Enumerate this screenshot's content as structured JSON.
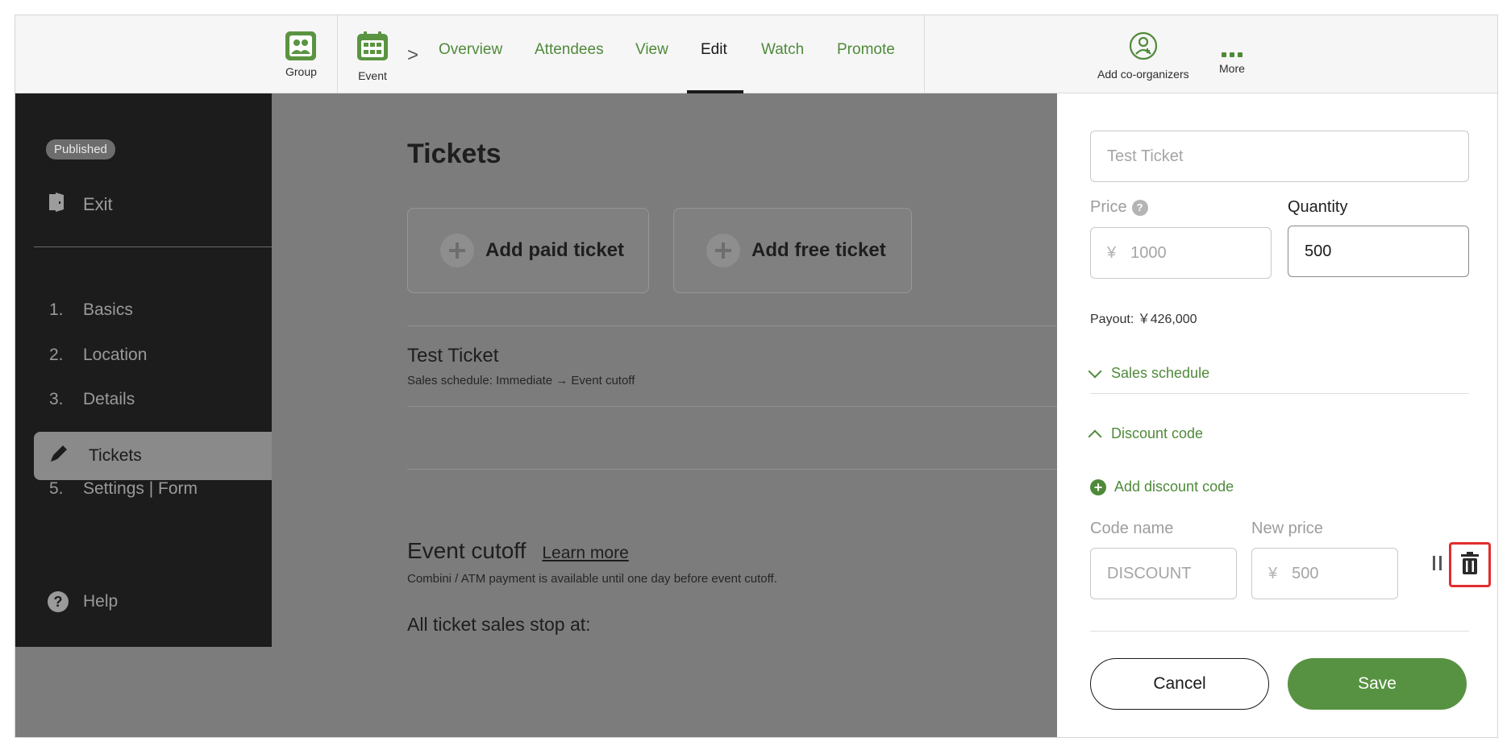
{
  "topbar": {
    "group_label": "Group",
    "event_label": "Event",
    "crumb_separator": ">",
    "tabs": [
      {
        "label": "Overview"
      },
      {
        "label": "Attendees"
      },
      {
        "label": "View"
      },
      {
        "label": "Edit",
        "active": true
      },
      {
        "label": "Watch"
      },
      {
        "label": "Promote"
      }
    ],
    "co_organizers_label": "Add co-organizers",
    "more_label": "More"
  },
  "sidebar": {
    "status_badge": "Published",
    "exit_label": "Exit",
    "steps": [
      {
        "num": "1.",
        "label": "Basics"
      },
      {
        "num": "2.",
        "label": "Location"
      },
      {
        "num": "3.",
        "label": "Details"
      },
      {
        "num": "",
        "label": "Tickets",
        "active": true
      },
      {
        "num": "5.",
        "label": "Settings | Form"
      }
    ],
    "help_label": "Help"
  },
  "main": {
    "title": "Tickets",
    "add_paid_label": "Add paid ticket",
    "add_free_label": "Add free ticket",
    "ticket_name": "Test Ticket",
    "ticket_schedule": "Sales schedule: Immediate → Event cutoff",
    "cutoff_title": "Event cutoff",
    "learn_more": "Learn more",
    "cutoff_note": "Combini / ATM payment is available until one day before event cutoff.",
    "stop_at": "All ticket sales stop at:"
  },
  "panel": {
    "ticket_name_value": "Test Ticket",
    "price_label": "Price",
    "price_currency": "¥",
    "price_value": "1000",
    "quantity_label": "Quantity",
    "quantity_value": "500",
    "payout_text": "Payout: ￥426,000",
    "sales_schedule_label": "Sales schedule",
    "discount_code_label": "Discount code",
    "add_discount_label": "Add discount code",
    "code_name_label": "Code name",
    "code_name_value": "DISCOUNT",
    "new_price_label": "New price",
    "new_price_currency": "¥",
    "new_price_value": "500",
    "cancel_label": "Cancel",
    "save_label": "Save"
  },
  "colors": {
    "brand_green": "#579242",
    "link_green": "#4f8a3a",
    "sidebar_bg": "#1c1c1c",
    "overlay_gray": "#7c7c7c",
    "highlight_red": "#e22d2d"
  }
}
